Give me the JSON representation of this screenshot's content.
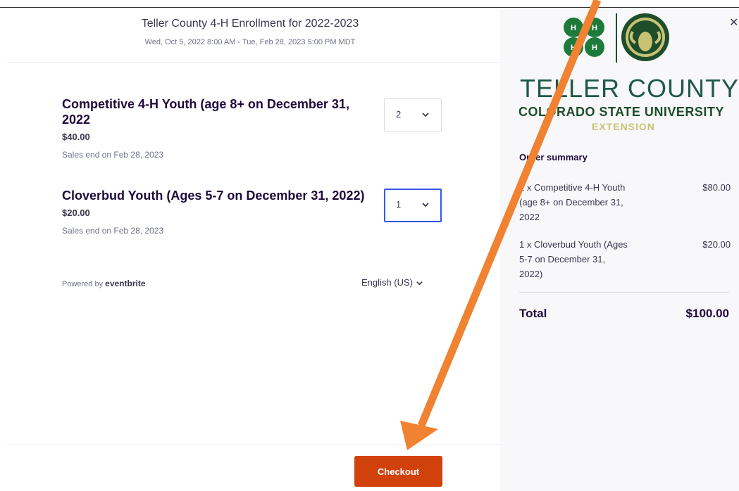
{
  "event": {
    "title": "Teller County 4-H Enrollment for 2022-2023",
    "dates": "Wed, Oct 5, 2022 8:00 AM - Tue, Feb 28, 2023 5:00 PM MDT"
  },
  "tickets": [
    {
      "name": "Competitive 4-H Youth (age 8+ on December 31, 2022",
      "price": "$40.00",
      "sales_end": "Sales end on Feb 28, 2023",
      "quantity": "2"
    },
    {
      "name": "Cloverbud Youth (Ages 5-7 on December 31, 2022)",
      "price": "$20.00",
      "sales_end": "Sales end on Feb 28, 2023",
      "quantity": "1"
    }
  ],
  "footer": {
    "powered_prefix": "Powered by",
    "powered_brand": "eventbrite",
    "language": "English (US)",
    "checkout_label": "Checkout"
  },
  "sidebar": {
    "logo": {
      "county": "TELLER COUNTY",
      "university": "COLORADO STATE UNIVERSITY",
      "unit": "EXTENSION"
    },
    "summary_title": "Order summary",
    "items": [
      {
        "desc": "2 x Competitive 4-H Youth (age 8+ on December 31, 2022",
        "amount": "$80.00"
      },
      {
        "desc": "1 x Cloverbud Youth (Ages 5-7 on December 31, 2022)",
        "amount": "$20.00"
      }
    ],
    "total_label": "Total",
    "total_amount": "$100.00"
  },
  "colors": {
    "checkout_bg": "#d1410c",
    "focus_border": "#3659e3",
    "arrow": "#f08232",
    "clover_green": "#1e7a3a",
    "csu_green": "#1e4d2b"
  },
  "icons": [
    "chevron-down-icon",
    "close-icon",
    "four-h-clover-icon",
    "csu-ram-logo-icon",
    "annotation-arrow-icon"
  ]
}
